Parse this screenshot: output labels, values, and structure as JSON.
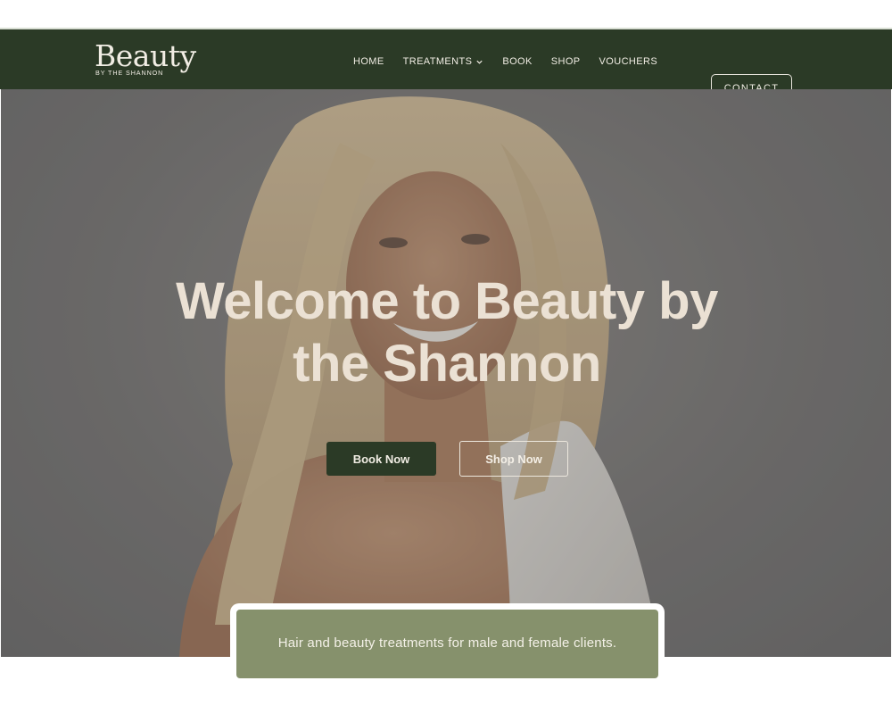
{
  "brand": {
    "logo_word": "Beauty",
    "logo_sub": "BY THE SHANNON",
    "colors": {
      "primary_green": "#2b3a26",
      "sage": "#86916c",
      "cream_text": "#ebe1d4"
    }
  },
  "nav": {
    "items": [
      {
        "label": "HOME"
      },
      {
        "label": "TREATMENTS",
        "icon": "chevron-down-icon"
      },
      {
        "label": "BOOK"
      },
      {
        "label": "SHOP"
      },
      {
        "label": "VOUCHERS"
      }
    ],
    "contact_label": "CONTACT"
  },
  "hero": {
    "title_line1": "Welcome to Beauty by",
    "title_line2": "the Shannon",
    "book_label": "Book Now",
    "shop_label": "Shop Now"
  },
  "tagline": {
    "text": "Hair and beauty treatments for male and female clients."
  }
}
